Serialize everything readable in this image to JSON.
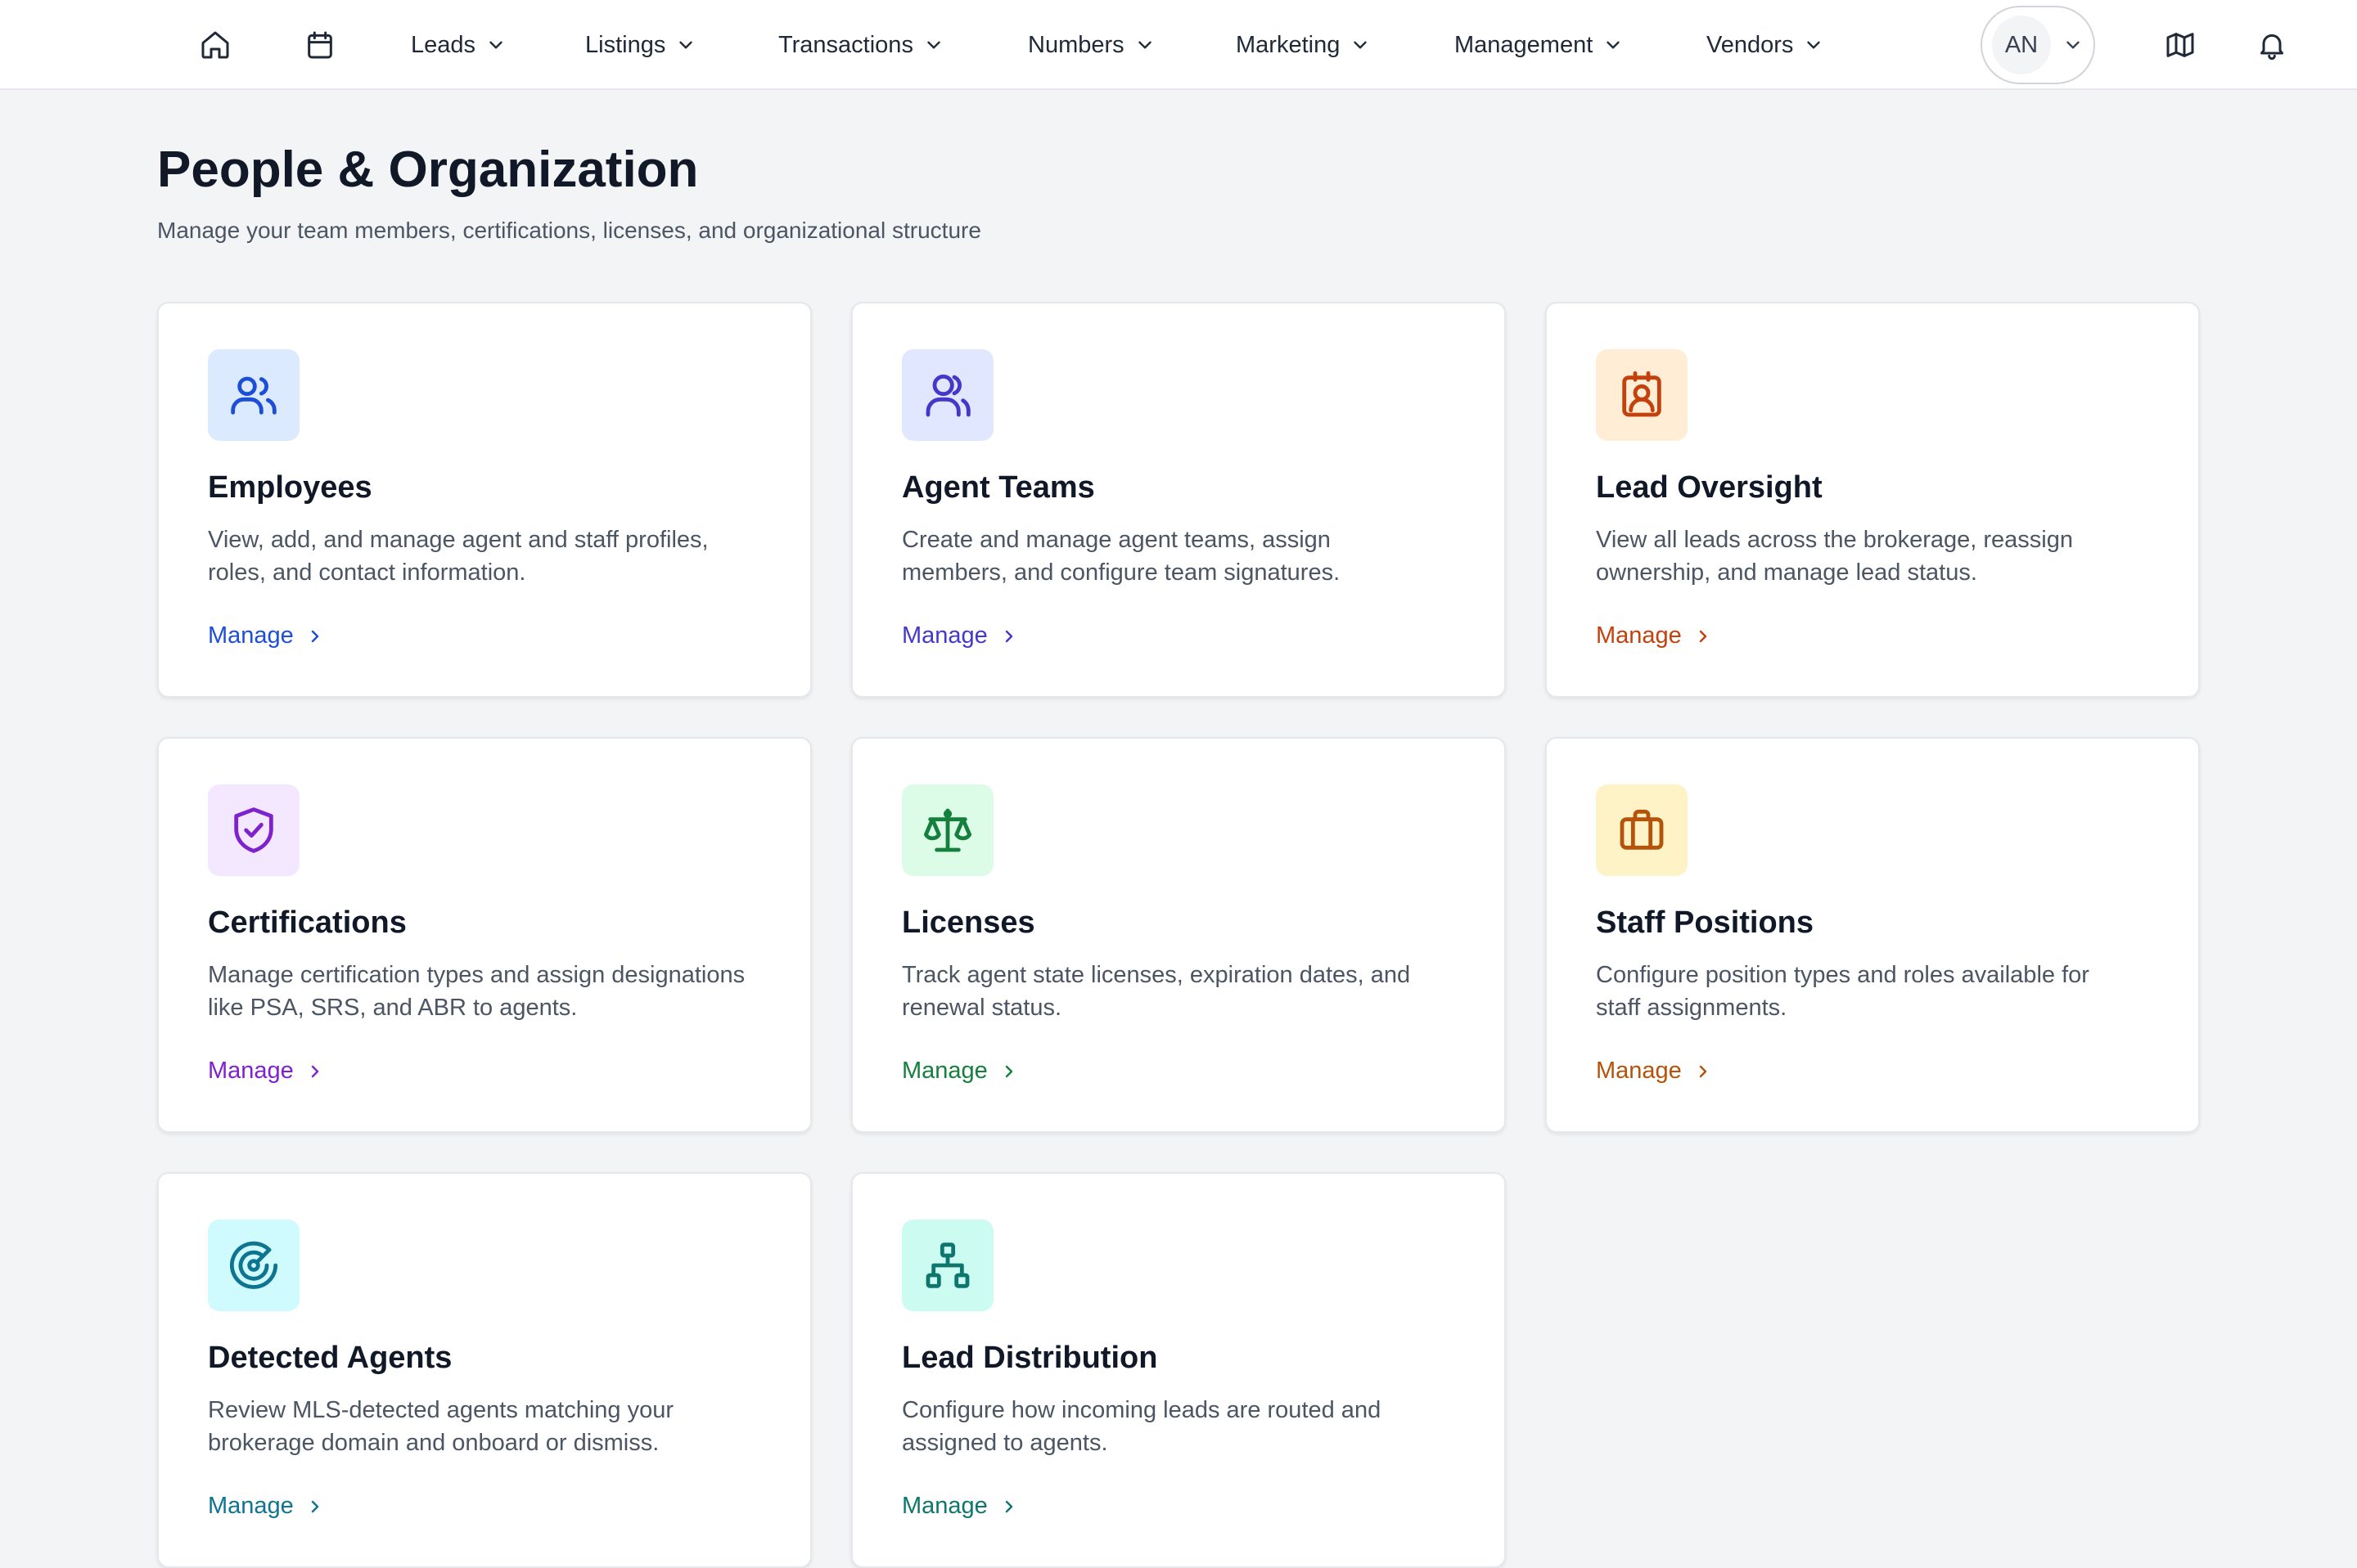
{
  "nav": {
    "home_icon": "home-icon",
    "calendar_icon": "calendar-icon",
    "menus": [
      {
        "label": "Leads"
      },
      {
        "label": "Listings"
      },
      {
        "label": "Transactions"
      },
      {
        "label": "Numbers"
      },
      {
        "label": "Marketing"
      },
      {
        "label": "Management"
      },
      {
        "label": "Vendors"
      }
    ],
    "user_initials": "AN",
    "map_icon": "map-icon",
    "bell_icon": "bell-icon"
  },
  "page": {
    "title": "People & Organization",
    "subtitle": "Manage your team members, certifications, licenses, and organizational structure"
  },
  "cards": [
    {
      "title": "Employees",
      "description": "View, add, and manage agent and staff profiles, roles, and contact information.",
      "link_label": "Manage",
      "icon": "users-icon",
      "icon_bg": "#dbeafe",
      "accent": "#1d4ed8"
    },
    {
      "title": "Agent Teams",
      "description": "Create and manage agent teams, assign members, and configure team signatures.",
      "link_label": "Manage",
      "icon": "user-group-icon",
      "icon_bg": "#e0e7ff",
      "accent": "#4338ca"
    },
    {
      "title": "Lead Oversight",
      "description": "View all leads across the brokerage, reassign ownership, and manage lead status.",
      "link_label": "Manage",
      "icon": "contact-badge-icon",
      "icon_bg": "#ffedd5",
      "accent": "#c2410c"
    },
    {
      "title": "Certifications",
      "description": "Manage certification types and assign designations like PSA, SRS, and ABR to agents.",
      "link_label": "Manage",
      "icon": "shield-check-icon",
      "icon_bg": "#f3e8ff",
      "accent": "#7e22ce"
    },
    {
      "title": "Licenses",
      "description": "Track agent state licenses, expiration dates, and renewal status.",
      "link_label": "Manage",
      "icon": "scale-icon",
      "icon_bg": "#dcfce7",
      "accent": "#15803d"
    },
    {
      "title": "Staff Positions",
      "description": "Configure position types and roles available for staff assignments.",
      "link_label": "Manage",
      "icon": "briefcase-icon",
      "icon_bg": "#fef3c7",
      "accent": "#b45309"
    },
    {
      "title": "Detected Agents",
      "description": "Review MLS-detected agents matching your brokerage domain and onboard or dismiss.",
      "link_label": "Manage",
      "icon": "radar-icon",
      "icon_bg": "#cffafe",
      "accent": "#0e7490"
    },
    {
      "title": "Lead Distribution",
      "description": "Configure how incoming leads are routed and assigned to agents.",
      "link_label": "Manage",
      "icon": "network-icon",
      "icon_bg": "#ccfbf1",
      "accent": "#0f766e"
    }
  ]
}
